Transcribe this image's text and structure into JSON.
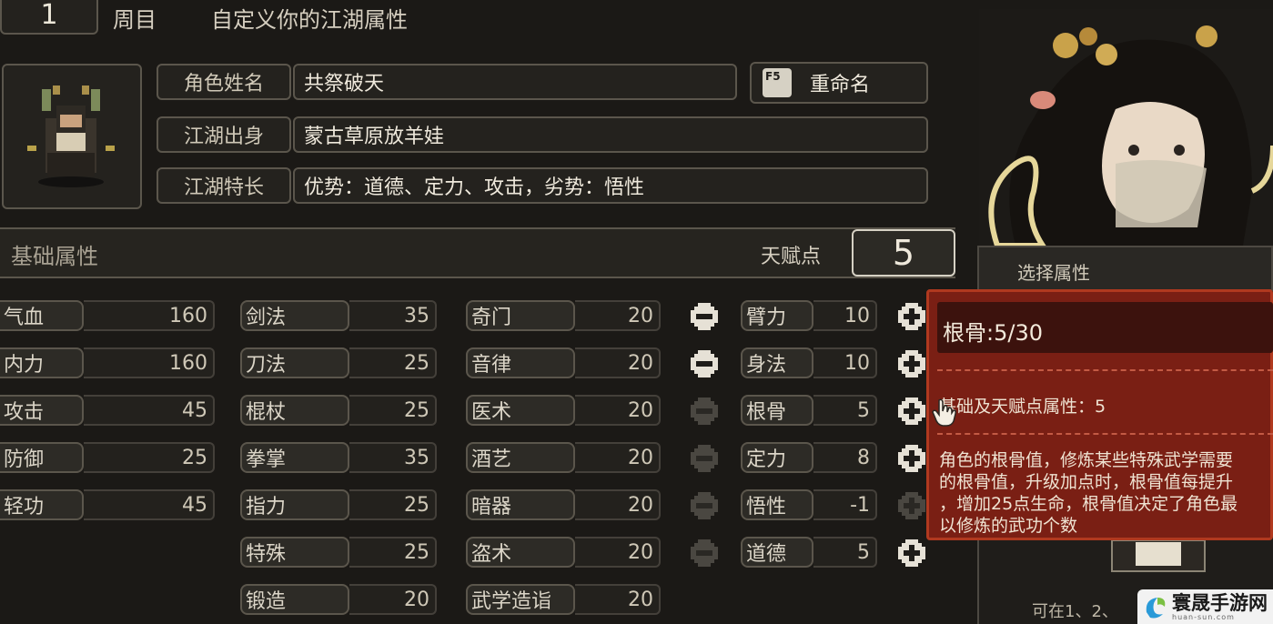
{
  "header": {
    "cycle_number": "1",
    "cycle_label": "周目",
    "title": "自定义你的江湖属性"
  },
  "profile": {
    "name_label": "角色姓名",
    "name_value": "共祭破天",
    "origin_label": "江湖出身",
    "origin_value": "蒙古草原放羊娃",
    "traits_label": "江湖特长",
    "traits_value": "优势：道德、定力、攻击，劣势：悟性",
    "rename_key": "F5",
    "rename_label": "重命名"
  },
  "basic": {
    "section_title": "基础属性",
    "talent_label": "天赋点",
    "talent_points": "5"
  },
  "stats_col1": [
    {
      "label": "气血",
      "value": "160"
    },
    {
      "label": "内力",
      "value": "160"
    },
    {
      "label": "攻击",
      "value": "45"
    },
    {
      "label": "防御",
      "value": "25"
    },
    {
      "label": "轻功",
      "value": "45"
    }
  ],
  "stats_col2": [
    {
      "label": "剑法",
      "value": "35"
    },
    {
      "label": "刀法",
      "value": "25"
    },
    {
      "label": "棍杖",
      "value": "25"
    },
    {
      "label": "拳掌",
      "value": "35"
    },
    {
      "label": "指力",
      "value": "25"
    },
    {
      "label": "特殊",
      "value": "25"
    },
    {
      "label": "锻造",
      "value": "20"
    }
  ],
  "stats_col3": [
    {
      "label": "奇门",
      "value": "20"
    },
    {
      "label": "音律",
      "value": "20"
    },
    {
      "label": "医术",
      "value": "20"
    },
    {
      "label": "酒艺",
      "value": "20"
    },
    {
      "label": "暗器",
      "value": "20"
    },
    {
      "label": "盗术",
      "value": "20"
    },
    {
      "label": "武学造诣",
      "value": "20"
    }
  ],
  "attributes": [
    {
      "label": "臂力",
      "value": "10",
      "minus_enabled": true,
      "plus_enabled": true
    },
    {
      "label": "身法",
      "value": "10",
      "minus_enabled": true,
      "plus_enabled": true
    },
    {
      "label": "根骨",
      "value": "5",
      "minus_enabled": false,
      "plus_enabled": true
    },
    {
      "label": "定力",
      "value": "8",
      "minus_enabled": false,
      "plus_enabled": true
    },
    {
      "label": "悟性",
      "value": "-1",
      "minus_enabled": false,
      "plus_enabled": false
    },
    {
      "label": "道德",
      "value": "5",
      "minus_enabled": false,
      "plus_enabled": true
    }
  ],
  "side_panel": {
    "select_label": "选择属性",
    "bottom_hint": "可在1、2、"
  },
  "tooltip": {
    "title": "根骨:5/30",
    "base_line": "基础及天赋点属性：5",
    "desc_lines": [
      "角色的根骨值，修炼某些特殊武学需要",
      "的根骨值，升级加点时，根骨值每提升",
      "，增加25点生命，根骨值决定了角色最",
      "以修炼的武功个数"
    ]
  },
  "watermark": {
    "text": "寰晟手游网",
    "sub": "huan-sun.com"
  },
  "colors": {
    "background": "#1b1916",
    "tooltip_bg": "#7a1f14",
    "tooltip_border": "#b0391f",
    "text": "#d9d3c4"
  }
}
